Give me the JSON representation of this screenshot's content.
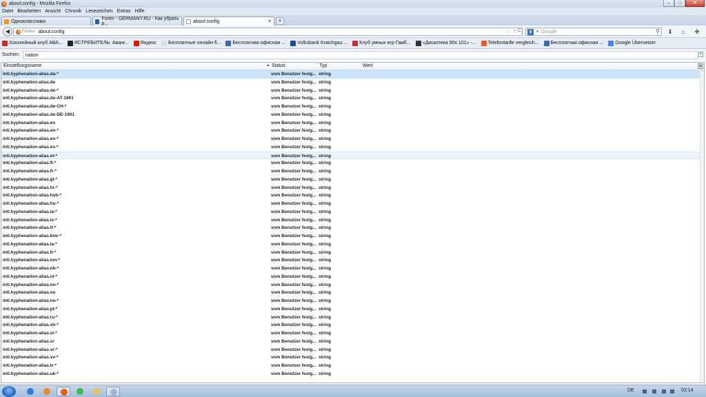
{
  "window": {
    "title": "about:config - Mozilla Firefox",
    "minimize_glyph": "–",
    "maximize_glyph": "□",
    "close_glyph": "✕"
  },
  "menu": [
    "Datei",
    "Bearbeiten",
    "Ansicht",
    "Chronik",
    "Lesezeichen",
    "Extras",
    "Hilfe"
  ],
  "tabs": [
    {
      "label": "Одноклассники",
      "icon": "odnoklassniki-icon",
      "color": "#f7931e"
    },
    {
      "label": "Foren - GERMANY.RU - Как убрать р...",
      "icon": "germany-ru-icon",
      "color": "#2f5fa8"
    },
    {
      "label": "about:config",
      "icon": "blank-page-icon",
      "color": "#ffffff"
    }
  ],
  "tab_close_glyph": "✕",
  "new_tab_glyph": "+",
  "navbar": {
    "back_glyph": "◀",
    "identity_label": "Firefox",
    "url": "about:config",
    "star_glyph": "☆",
    "dropdown_glyph": "▽",
    "reload_glyph": "C",
    "search_engine_label": "g",
    "search_dropdown_glyph": "▼",
    "search_placeholder": "Google",
    "search_glyph": "⚲",
    "download_glyph": "⬇",
    "home_glyph": "⌂",
    "addon_glyph": "✚"
  },
  "bookmarks": [
    {
      "label": "Хохххейный клуб АВА...",
      "icon": "red-circle-icon",
      "color": "#d9261c"
    },
    {
      "label": "ЯСТРЕБИТЕЛЬ: Аванг...",
      "icon": "game-icon",
      "color": "#222222"
    },
    {
      "label": "Яндекс",
      "icon": "yandex-icon",
      "color": "#e61400"
    },
    {
      "label": "Бесплатные онлайн fl...",
      "icon": "page-icon",
      "color": "#dddddd"
    },
    {
      "label": "Бесплатная офисная ...",
      "icon": "office-icon",
      "color": "#3b6db5"
    },
    {
      "label": "Volksbank Kraichgau ...",
      "icon": "volksbank-icon",
      "color": "#1f4a9b"
    },
    {
      "label": "Клуб умных игр Гамб...",
      "icon": "club-icon",
      "color": "#d22a2a"
    },
    {
      "label": "«Дискотека 90х.101» -...",
      "icon": "disco-icon",
      "color": "#333333"
    },
    {
      "label": "Telefontarife vergleich...",
      "icon": "telefon-icon",
      "color": "#f15a24"
    },
    {
      "label": "Бесплатная офисная ...",
      "icon": "office-icon",
      "color": "#3b6db5"
    },
    {
      "label": "Google Übersetzer",
      "icon": "google-translate-icon",
      "color": "#4285f4"
    }
  ],
  "filter": {
    "label": "Suchen:",
    "value": "nation",
    "clear_glyph": "×"
  },
  "columns": {
    "name": "Einstellungsname",
    "status": "Status",
    "type": "Typ",
    "value": "Wert",
    "sort_glyph": "▲",
    "picker_glyph": "▤"
  },
  "rows": [
    {
      "name": "intl.hyphenation-alias.da-*",
      "status": "vom Benutzer festg...",
      "type": "string",
      "value": ""
    },
    {
      "name": "intl.hyphenation-alias.de",
      "status": "vom Benutzer festg...",
      "type": "string",
      "value": ""
    },
    {
      "name": "intl.hyphenation-alias.de-*",
      "status": "vom Benutzer festg...",
      "type": "string",
      "value": ""
    },
    {
      "name": "intl.hyphenation-alias.de-AT-1901",
      "status": "vom Benutzer festg...",
      "type": "string",
      "value": ""
    },
    {
      "name": "intl.hyphenation-alias.de-CH-*",
      "status": "vom Benutzer festg...",
      "type": "string",
      "value": ""
    },
    {
      "name": "intl.hyphenation-alias.de-DE-1901",
      "status": "vom Benutzer festg...",
      "type": "string",
      "value": ""
    },
    {
      "name": "intl.hyphenation-alias.en",
      "status": "vom Benutzer festg...",
      "type": "string",
      "value": ""
    },
    {
      "name": "intl.hyphenation-alias.en-*",
      "status": "vom Benutzer festg...",
      "type": "string",
      "value": ""
    },
    {
      "name": "intl.hyphenation-alias.eo-*",
      "status": "vom Benutzer festg...",
      "type": "string",
      "value": ""
    },
    {
      "name": "intl.hyphenation-alias.es-*",
      "status": "vom Benutzer festg...",
      "type": "string",
      "value": ""
    },
    {
      "name": "intl.hyphenation-alias.et-*",
      "status": "vom Benutzer festg...",
      "type": "string",
      "value": ""
    },
    {
      "name": "intl.hyphenation-alias.fi-*",
      "status": "vom Benutzer festg...",
      "type": "string",
      "value": ""
    },
    {
      "name": "intl.hyphenation-alias.fr-*",
      "status": "vom Benutzer festg...",
      "type": "string",
      "value": ""
    },
    {
      "name": "intl.hyphenation-alias.gl-*",
      "status": "vom Benutzer festg...",
      "type": "string",
      "value": ""
    },
    {
      "name": "intl.hyphenation-alias.hr-*",
      "status": "vom Benutzer festg...",
      "type": "string",
      "value": ""
    },
    {
      "name": "intl.hyphenation-alias.hsb-*",
      "status": "vom Benutzer festg...",
      "type": "string",
      "value": ""
    },
    {
      "name": "intl.hyphenation-alias.hu-*",
      "status": "vom Benutzer festg...",
      "type": "string",
      "value": ""
    },
    {
      "name": "intl.hyphenation-alias.ia-*",
      "status": "vom Benutzer festg...",
      "type": "string",
      "value": ""
    },
    {
      "name": "intl.hyphenation-alias.is-*",
      "status": "vom Benutzer festg...",
      "type": "string",
      "value": ""
    },
    {
      "name": "intl.hyphenation-alias.it-*",
      "status": "vom Benutzer festg...",
      "type": "string",
      "value": ""
    },
    {
      "name": "intl.hyphenation-alias.kmr-*",
      "status": "vom Benutzer festg...",
      "type": "string",
      "value": ""
    },
    {
      "name": "intl.hyphenation-alias.la-*",
      "status": "vom Benutzer festg...",
      "type": "string",
      "value": ""
    },
    {
      "name": "intl.hyphenation-alias.lt-*",
      "status": "vom Benutzer festg...",
      "type": "string",
      "value": ""
    },
    {
      "name": "intl.hyphenation-alias.mn-*",
      "status": "vom Benutzer festg...",
      "type": "string",
      "value": ""
    },
    {
      "name": "intl.hyphenation-alias.nb-*",
      "status": "vom Benutzer festg...",
      "type": "string",
      "value": ""
    },
    {
      "name": "intl.hyphenation-alias.nl-*",
      "status": "vom Benutzer festg...",
      "type": "string",
      "value": ""
    },
    {
      "name": "intl.hyphenation-alias.nn-*",
      "status": "vom Benutzer festg...",
      "type": "string",
      "value": ""
    },
    {
      "name": "intl.hyphenation-alias.no",
      "status": "vom Benutzer festg...",
      "type": "string",
      "value": ""
    },
    {
      "name": "intl.hyphenation-alias.no-*",
      "status": "vom Benutzer festg...",
      "type": "string",
      "value": ""
    },
    {
      "name": "intl.hyphenation-alias.pt-*",
      "status": "vom Benutzer festg...",
      "type": "string",
      "value": ""
    },
    {
      "name": "intl.hyphenation-alias.ru-*",
      "status": "vom Benutzer festg...",
      "type": "string",
      "value": ""
    },
    {
      "name": "intl.hyphenation-alias.sh-*",
      "status": "vom Benutzer festg...",
      "type": "string",
      "value": ""
    },
    {
      "name": "intl.hyphenation-alias.sl-*",
      "status": "vom Benutzer festg...",
      "type": "string",
      "value": ""
    },
    {
      "name": "intl.hyphenation-alias.sr",
      "status": "vom Benutzer festg...",
      "type": "string",
      "value": ""
    },
    {
      "name": "intl.hyphenation-alias.sr-*",
      "status": "vom Benutzer festg...",
      "type": "string",
      "value": ""
    },
    {
      "name": "intl.hyphenation-alias.sv-*",
      "status": "vom Benutzer festg...",
      "type": "string",
      "value": ""
    },
    {
      "name": "intl.hyphenation-alias.tr-*",
      "status": "vom Benutzer festg...",
      "type": "string",
      "value": ""
    },
    {
      "name": "intl.hyphenation-alias.uk-*",
      "status": "vom Benutzer festg...",
      "type": "string",
      "value": ""
    }
  ],
  "selected_row": 0,
  "hovered_row": 10,
  "taskbar": {
    "apps": [
      {
        "icon": "windows-explorer-icon",
        "color": "#2f7ed8",
        "active": false
      },
      {
        "icon": "media-player-icon",
        "color": "#f08a24",
        "active": false
      },
      {
        "icon": "firefox-icon",
        "color": "#e35d11",
        "active": true
      },
      {
        "icon": "chrome-icon",
        "color": "#3cba54",
        "active": false
      },
      {
        "icon": "folder-icon",
        "color": "#e9c45a",
        "active": false
      },
      {
        "icon": "window-icon",
        "color": "#9fb6d3",
        "active": true
      }
    ],
    "language": "DE",
    "clock": "02:14"
  }
}
